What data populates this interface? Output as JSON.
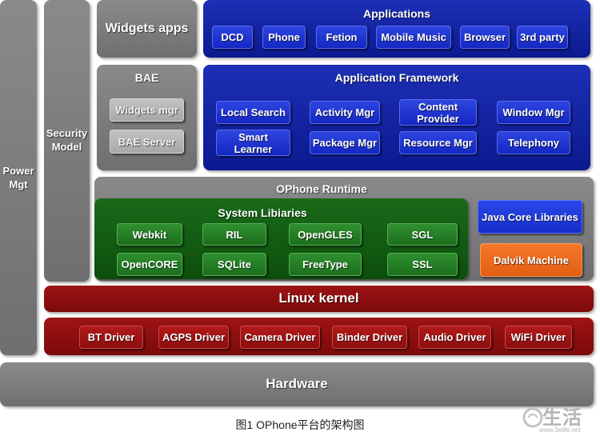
{
  "power_mgt": "Power\nMgt",
  "security_model": "Security\nModel",
  "widgets_apps": "Widgets apps",
  "bae": {
    "title": "BAE",
    "items": [
      "Widgets mgr",
      "BAE Server"
    ]
  },
  "applications": {
    "title": "Applications",
    "items": [
      "DCD",
      "Phone",
      "Fetion",
      "Mobile Music",
      "Browser",
      "3rd party"
    ]
  },
  "framework": {
    "title": "Application Framework",
    "items": [
      "Local Search",
      "Activity Mgr",
      "Content\nProvider",
      "Window Mgr",
      "Smart\nLearner",
      "Package Mgr",
      "Resource Mgr",
      "Telephony"
    ]
  },
  "runtime": {
    "title": "OPhone Runtime",
    "java_core": "Java Core Libraries",
    "dalvik": "Dalvik Machine"
  },
  "system_libraries": {
    "title": "System Libiaries",
    "items": [
      "Webkit",
      "RIL",
      "OpenGLES",
      "SGL",
      "OpenCORE",
      "SQLite",
      "FreeType",
      "SSL"
    ]
  },
  "linux_kernel": "Linux kernel",
  "drivers": [
    "BT Driver",
    "AGPS Driver",
    "Camera Driver",
    "Binder Driver",
    "Audio Driver",
    "WiFi Driver"
  ],
  "hardware": "Hardware",
  "caption": "图1 OPhone平台的架构图",
  "watermark": {
    "text": "生活",
    "url": "www.3elife.net"
  },
  "colors": {
    "gray_layer": "#7a7a7a",
    "blue_layer": "#0f1f9a",
    "green_layer": "#145c14",
    "red_layer": "#8a0f0f",
    "orange_chip": "#f26a1b",
    "java_chip": "#1a36d6"
  }
}
